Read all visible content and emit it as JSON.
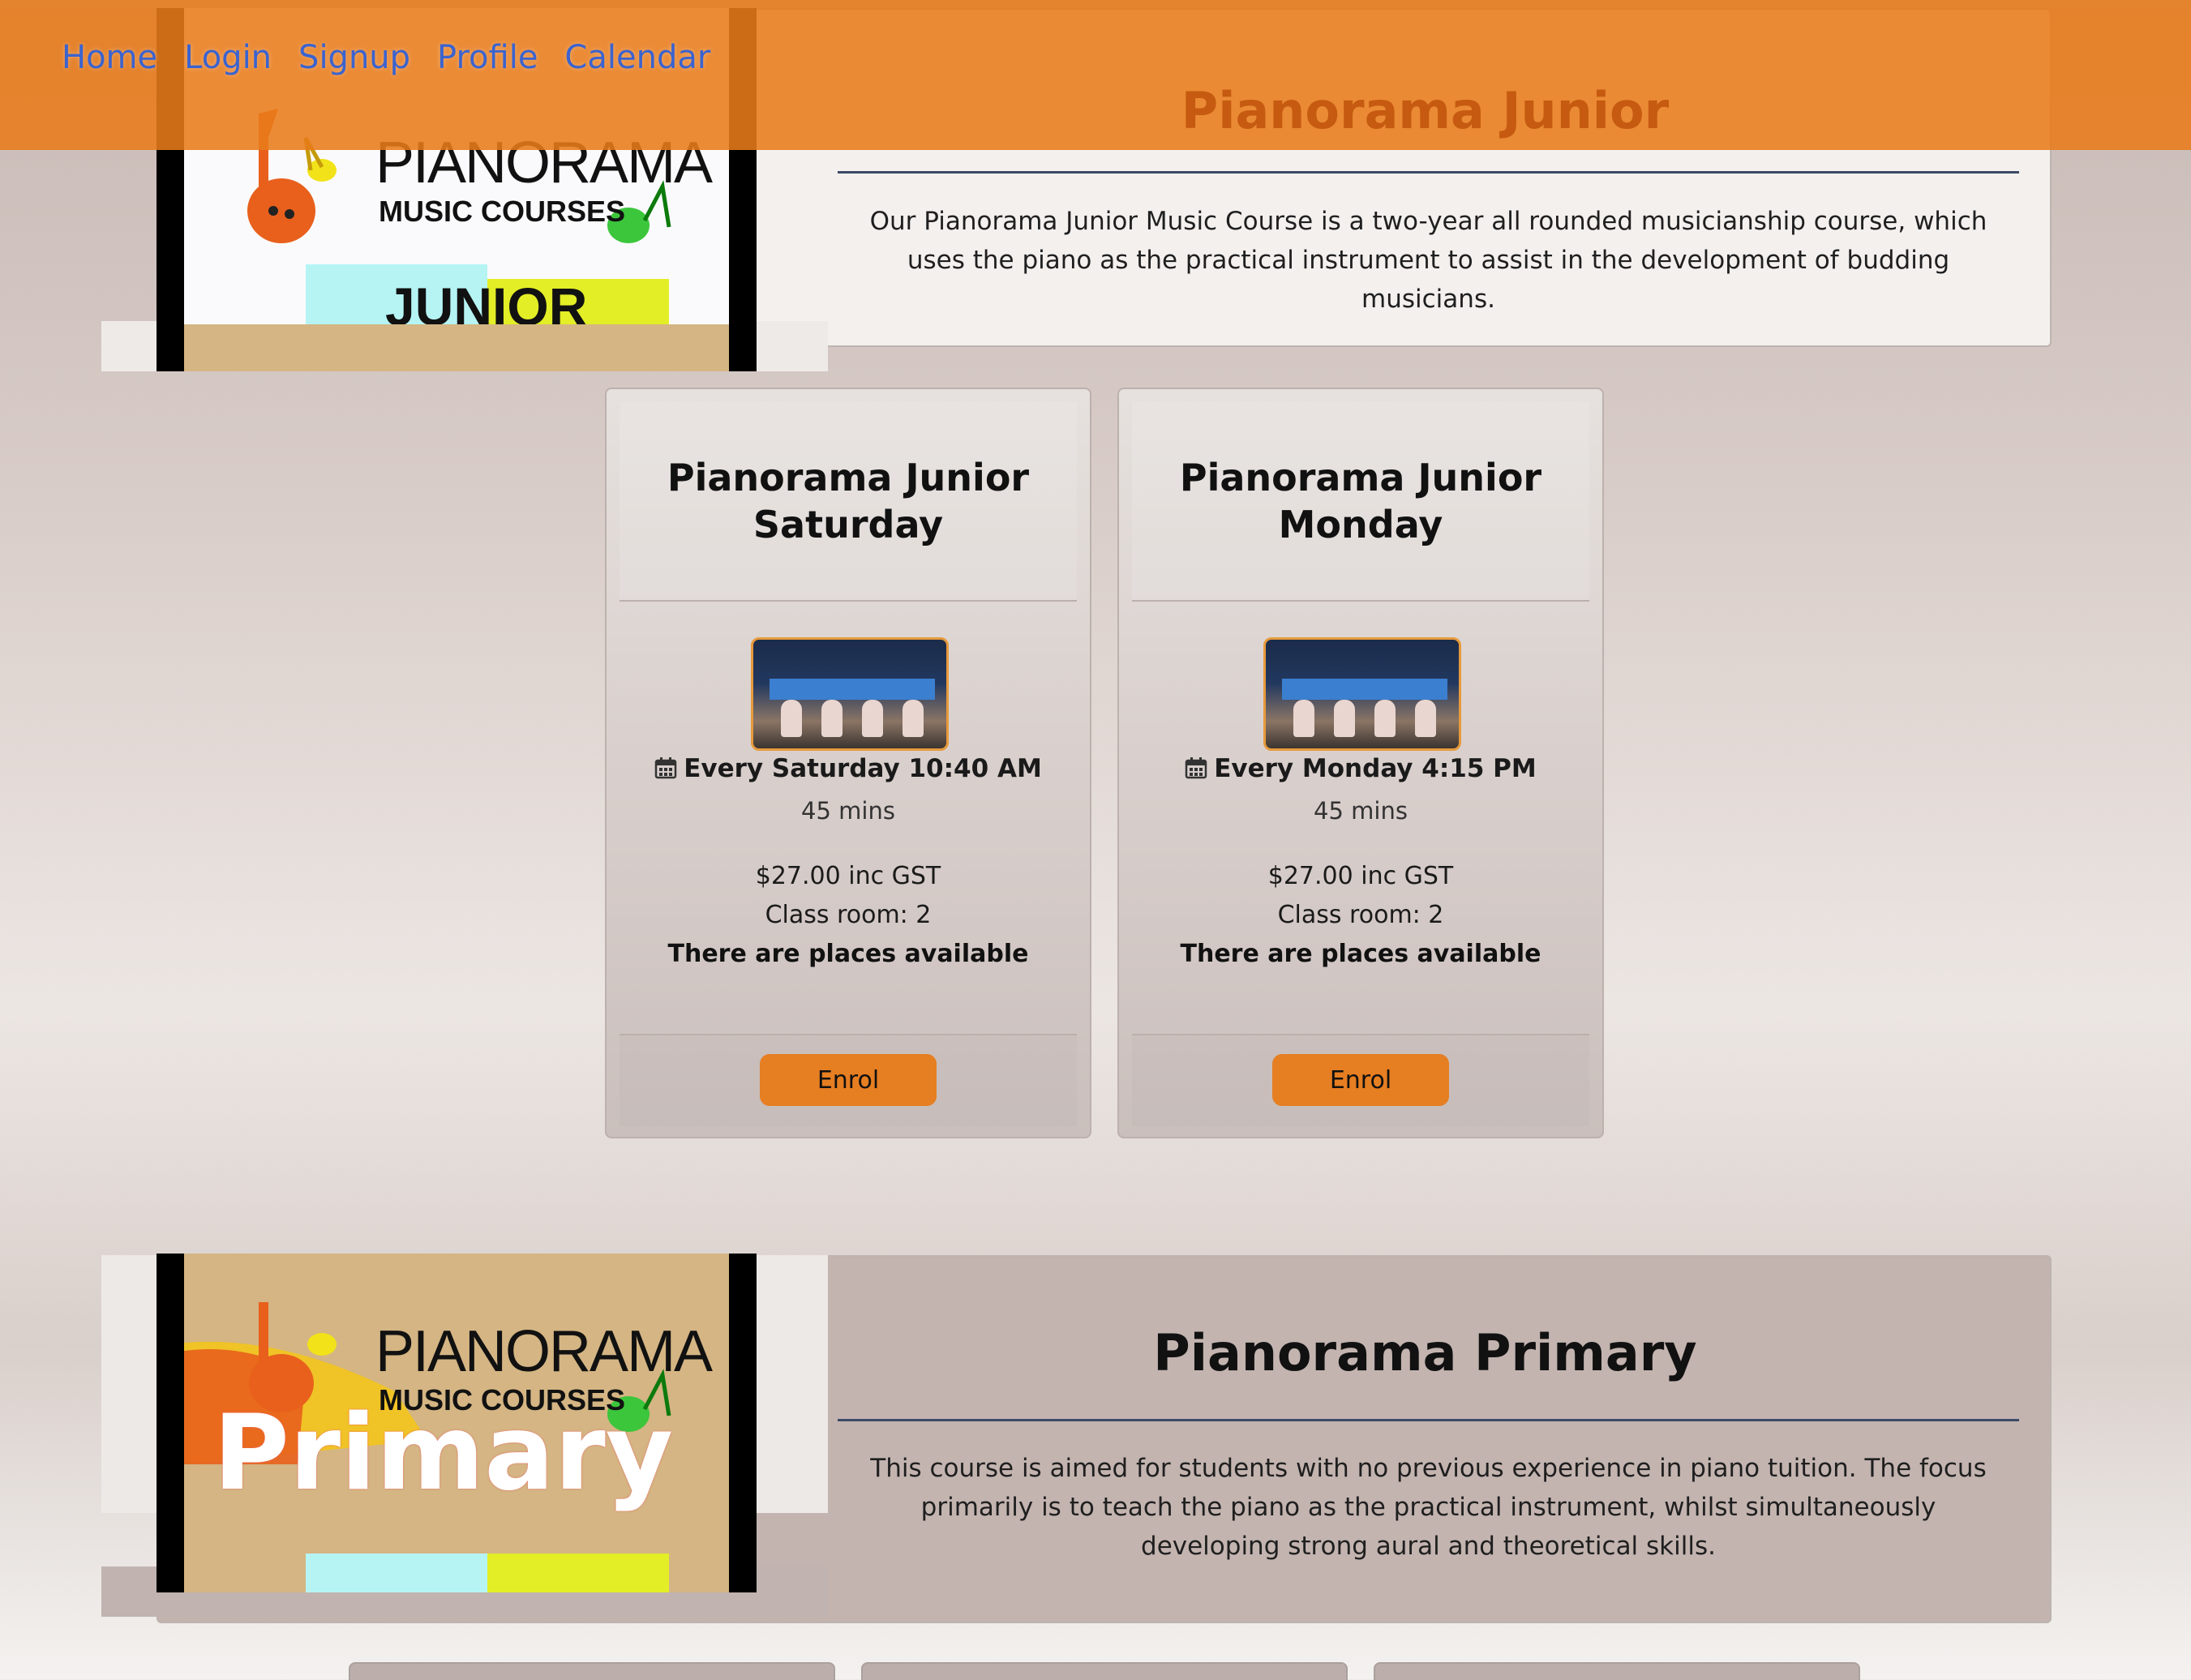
{
  "nav": {
    "links": [
      "Home",
      "Login",
      "Signup",
      "Profile",
      "Calendar"
    ]
  },
  "courses": [
    {
      "title": "Pianorama Junior",
      "description": "Our Pianorama Junior Music Course is a two-year all rounded musicianship course, which uses the piano as the practical instrument to assist in the development of budding musicians.",
      "logo": {
        "brand": "PIANORAMA",
        "subtitle": "MUSIC COURSES",
        "tag": "JUNIOR"
      }
    },
    {
      "title": "Pianorama Primary",
      "description": "This course is aimed for students with no previous experience in piano tuition. The focus primarily is to teach the piano as the practical instrument, whilst simultaneously developing strong aural and theoretical skills.",
      "logo": {
        "brand": "PIANORAMA",
        "subtitle": "MUSIC COURSES",
        "tag": "Primary"
      }
    }
  ],
  "classes": [
    {
      "title": "Pianorama Junior Saturday",
      "time": "Every Saturday 10:40 AM",
      "duration": "45 mins",
      "price": "$27.00 inc GST",
      "room": "Class room: 2",
      "availability": "There are places available",
      "button": "Enrol"
    },
    {
      "title": "Pianorama Junior Monday",
      "time": "Every Monday 4:15 PM",
      "duration": "45 mins",
      "price": "$27.00 inc GST",
      "room": "Class room: 2",
      "availability": "There are places available",
      "button": "Enrol"
    }
  ],
  "colors": {
    "nav_bg": "#e87b1a",
    "accent": "#e67e22",
    "link": "#3b63cf",
    "title_junior": "#c55a10"
  },
  "icons": {
    "calendar": "calendar-icon"
  }
}
